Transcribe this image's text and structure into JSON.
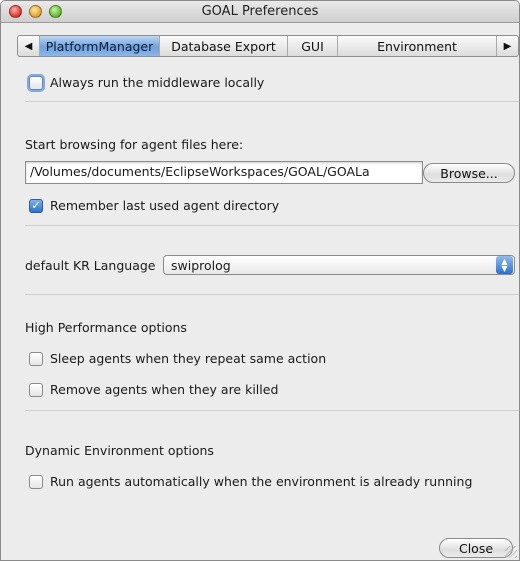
{
  "window": {
    "title": "GOAL Preferences"
  },
  "tabs": {
    "left_arrow": "◀",
    "right_arrow": "▶",
    "items": [
      {
        "label": "PlatformManager",
        "selected": true
      },
      {
        "label": "Database Export",
        "selected": false
      },
      {
        "label": "GUI",
        "selected": false
      },
      {
        "label": "Environment",
        "selected": false
      }
    ]
  },
  "platform": {
    "always_local": {
      "label": "Always run the middleware locally",
      "checked": false
    },
    "browse_heading": "Start browsing for agent files here:",
    "agent_path": "/Volumes/documents/EclipseWorkspaces/GOAL/GOALa",
    "browse_label": "Browse...",
    "remember_dir": {
      "label": "Remember last used agent directory",
      "checked": true
    },
    "kr_label": "default KR Language",
    "kr_value": "swiprolog",
    "perf_heading": "High Performance options",
    "sleep_agents": {
      "label": "Sleep agents when they repeat same action",
      "checked": false
    },
    "remove_agents": {
      "label": "Remove agents when they are killed",
      "checked": false
    },
    "dyn_heading": "Dynamic Environment options",
    "run_auto": {
      "label": "Run agents automatically when the environment is already running",
      "checked": false
    }
  },
  "footer": {
    "close_label": "Close"
  },
  "colors": {
    "selected_tab": "#6fa2de",
    "accent": "#2f73cc",
    "window_bg": "#ececec"
  }
}
